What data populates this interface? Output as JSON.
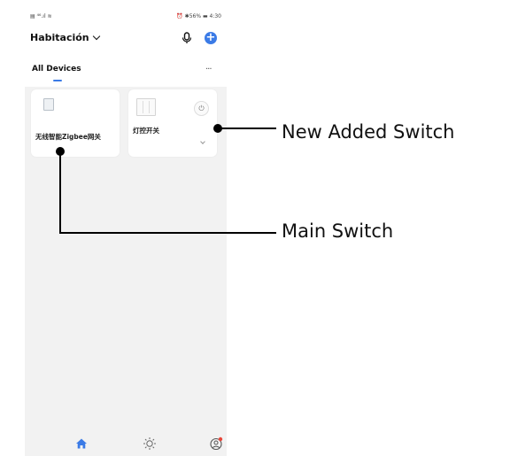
{
  "status_bar": {
    "left": "▤ ⁴⁶.ıl ≋",
    "right": "⏰ ✱56% ▬ 4:30"
  },
  "header": {
    "room": "Habitación",
    "icons": [
      "mic-icon",
      "add-icon"
    ]
  },
  "tabs": {
    "active": "All Devices",
    "more": "···"
  },
  "devices": [
    {
      "name": "无线智能Zigbee网关",
      "icon": "gateway-icon"
    },
    {
      "name": "灯控开关",
      "icon": "wall-switch-icon",
      "power_glyph": "⏻"
    }
  ],
  "bottom_nav": [
    "home-icon",
    "scene-sun-icon",
    "profile-icon"
  ],
  "annotations": {
    "new_switch": "New Added Switch",
    "main_switch": "Main Switch"
  },
  "colors": {
    "accent": "#3b7be6",
    "notification": "#e8463a"
  }
}
